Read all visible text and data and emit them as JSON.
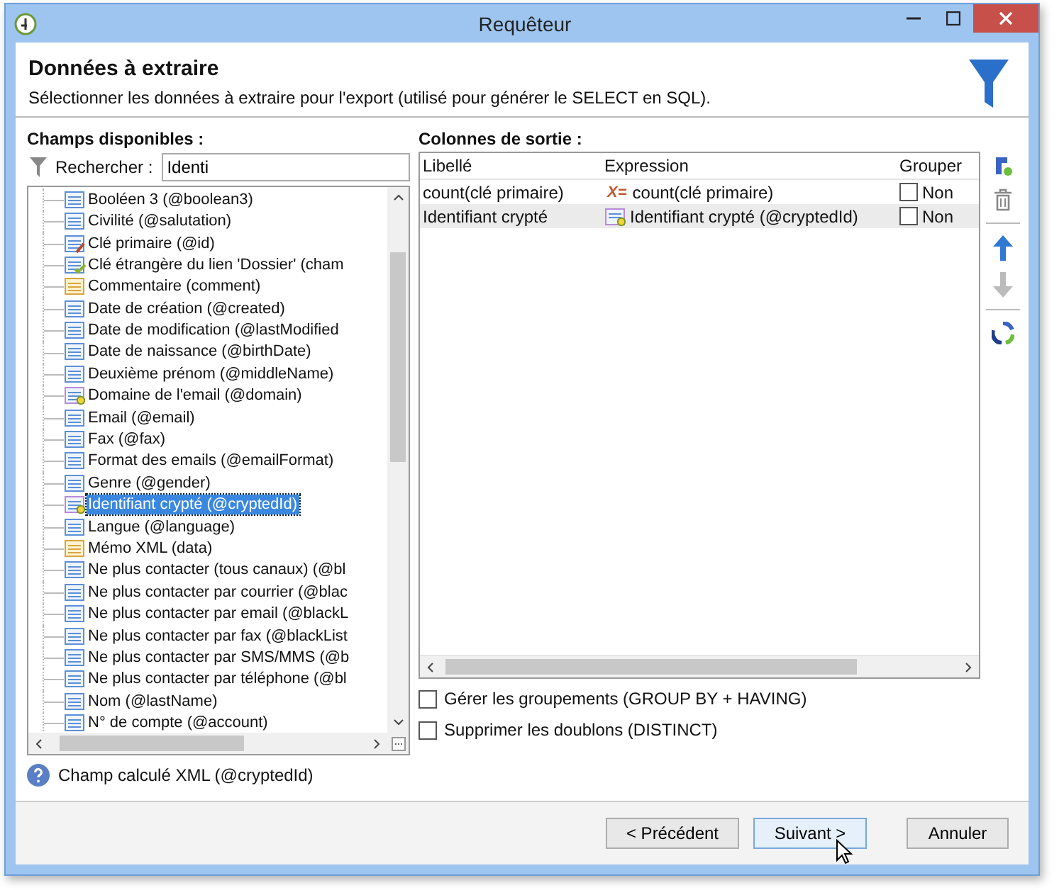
{
  "window": {
    "title": "Requêteur"
  },
  "header": {
    "title": "Données à extraire",
    "description": "Sélectionner les données à extraire pour l'export (utilisé pour générer le SELECT en SQL)."
  },
  "fields_panel": {
    "label": "Champs disponibles :",
    "search": {
      "label": "Rechercher :",
      "value": "Identi"
    },
    "items": [
      {
        "label": "Booléen 3 (@boolean3)",
        "kind": "field",
        "selected": false
      },
      {
        "label": "Civilité (@salutation)",
        "kind": "field",
        "selected": false
      },
      {
        "label": "Clé primaire (@id)",
        "kind": "key",
        "selected": false
      },
      {
        "label": "Clé étrangère du lien 'Dossier' (cham",
        "kind": "link",
        "selected": false
      },
      {
        "label": "Commentaire (comment)",
        "kind": "memo",
        "selected": false
      },
      {
        "label": "Date de création (@created)",
        "kind": "field",
        "selected": false
      },
      {
        "label": "Date de modification (@lastModified",
        "kind": "field",
        "selected": false
      },
      {
        "label": "Date de naissance (@birthDate)",
        "kind": "field",
        "selected": false
      },
      {
        "label": "Deuxième prénom (@middleName)",
        "kind": "field",
        "selected": false
      },
      {
        "label": "Domaine de l'email (@domain)",
        "kind": "computed",
        "selected": false
      },
      {
        "label": "Email (@email)",
        "kind": "field",
        "selected": false
      },
      {
        "label": "Fax (@fax)",
        "kind": "field",
        "selected": false
      },
      {
        "label": "Format des emails (@emailFormat)",
        "kind": "field",
        "selected": false
      },
      {
        "label": "Genre (@gender)",
        "kind": "field",
        "selected": false
      },
      {
        "label": "Identifiant crypté (@cryptedId)",
        "kind": "computed",
        "selected": true
      },
      {
        "label": "Langue (@language)",
        "kind": "field",
        "selected": false
      },
      {
        "label": "Mémo XML (data)",
        "kind": "memo",
        "selected": false
      },
      {
        "label": "Ne plus contacter (tous canaux) (@bl",
        "kind": "field",
        "selected": false
      },
      {
        "label": "Ne plus contacter par courrier (@blac",
        "kind": "field",
        "selected": false
      },
      {
        "label": "Ne plus contacter par email (@blackL",
        "kind": "field",
        "selected": false
      },
      {
        "label": "Ne plus contacter par fax (@blackList",
        "kind": "field",
        "selected": false
      },
      {
        "label": "Ne plus contacter par SMS/MMS (@b",
        "kind": "field",
        "selected": false
      },
      {
        "label": "Ne plus contacter par téléphone (@bl",
        "kind": "field",
        "selected": false
      },
      {
        "label": "Nom (@lastName)",
        "kind": "field",
        "selected": false
      },
      {
        "label": "N° de compte (@account)",
        "kind": "field",
        "selected": false
      }
    ],
    "help": "Champ calculé XML (@cryptedId)"
  },
  "output_panel": {
    "label": "Colonnes de sortie :",
    "columns": [
      "Libellé",
      "Expression",
      "Grouper"
    ],
    "rows": [
      {
        "label": "count(clé primaire)",
        "expression": {
          "kind": "formula",
          "text": "count(clé primaire)"
        },
        "group": {
          "checked": false,
          "label": "Non"
        },
        "selected": false
      },
      {
        "label": "Identifiant crypté",
        "expression": {
          "kind": "computed",
          "text": "Identifiant crypté (@cryptedId)"
        },
        "group": {
          "checked": false,
          "label": "Non"
        },
        "selected": true
      }
    ],
    "formula_mark": "X=",
    "options": [
      {
        "label": "Gérer les groupements (GROUP BY + HAVING)",
        "checked": false
      },
      {
        "label": "Supprimer les doublons (DISTINCT)",
        "checked": false
      }
    ]
  },
  "buttons": [
    "< Précédent",
    "Suivant >",
    "Annuler"
  ]
}
